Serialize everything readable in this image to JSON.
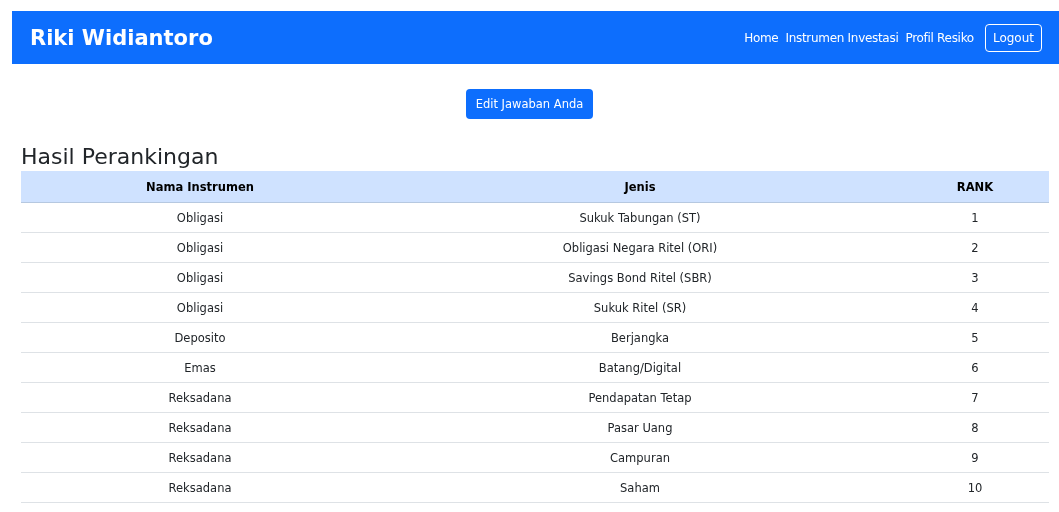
{
  "navbar": {
    "brand": "Riki Widiantoro",
    "links": [
      "Home",
      "Instrumen Investasi",
      "Profil Resiko"
    ],
    "logout": "Logout"
  },
  "edit_button": "Edit Jawaban Anda",
  "heading": "Hasil Perankingan",
  "table": {
    "columns": [
      "Nama Instrumen",
      "Jenis",
      "RANK"
    ],
    "rows": [
      [
        "Obligasi",
        "Sukuk Tabungan (ST)",
        "1"
      ],
      [
        "Obligasi",
        "Obligasi Negara Ritel (ORI)",
        "2"
      ],
      [
        "Obligasi",
        "Savings Bond Ritel (SBR)",
        "3"
      ],
      [
        "Obligasi",
        "Sukuk Ritel (SR)",
        "4"
      ],
      [
        "Deposito",
        "Berjangka",
        "5"
      ],
      [
        "Emas",
        "Batang/Digital",
        "6"
      ],
      [
        "Reksadana",
        "Pendapatan Tetap",
        "7"
      ],
      [
        "Reksadana",
        "Pasar Uang",
        "8"
      ],
      [
        "Reksadana",
        "Campuran",
        "9"
      ],
      [
        "Reksadana",
        "Saham",
        "10"
      ]
    ]
  }
}
